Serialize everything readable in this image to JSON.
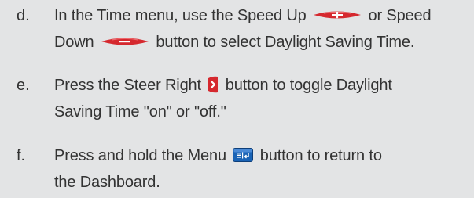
{
  "steps": [
    {
      "letter": "d.",
      "line1_a": "In the Time menu, use the Speed Up",
      "line1_b": "or Speed",
      "line2_a": "Down",
      "line2_b": "button to select Daylight Saving Time.",
      "icons": [
        "speed-up-icon",
        "speed-down-icon"
      ]
    },
    {
      "letter": "e.",
      "line1_a": "Press the Steer Right",
      "line1_b": "button to toggle Daylight",
      "line2": "Saving Time \"on\" or \"off.\"",
      "icons": [
        "steer-right-icon"
      ]
    },
    {
      "letter": "f.",
      "line1_a": "Press and hold the Menu",
      "line1_b": "button to return to",
      "line2": "the Dashboard.",
      "icons": [
        "menu-icon"
      ]
    }
  ],
  "colors": {
    "background": "#e3e4e5",
    "text": "#333333",
    "button_red": "#d5282e",
    "menu_blue": "#1a63b5"
  }
}
